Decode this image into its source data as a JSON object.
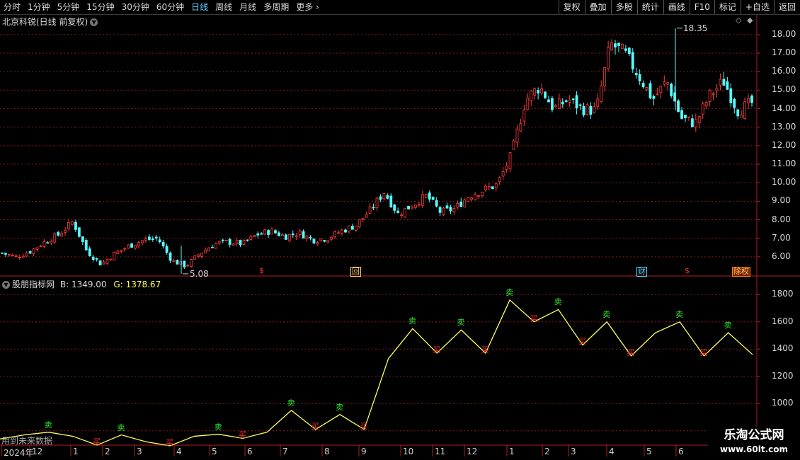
{
  "toolbar": {
    "periods": [
      "分时",
      "1分钟",
      "5分钟",
      "15分钟",
      "30分钟",
      "60分钟",
      "日线",
      "周线",
      "月线",
      "多周期",
      "更多"
    ],
    "active_period": "日线",
    "buttons": [
      "复权",
      "叠加",
      "多股",
      "统计",
      "画线",
      "F10",
      "标记",
      "+自选",
      "返回"
    ]
  },
  "main_pane": {
    "title": "北京科锐(日线 前复权)",
    "high_label": "18.35",
    "low_label": "5.08",
    "event_markers": [
      "$",
      "回",
      "财",
      "$",
      "除权"
    ]
  },
  "indicator_pane": {
    "title": "股朋指标网",
    "b_label": "B:",
    "b_value": "1349.00",
    "g_label": "G:",
    "g_value": "1378.67",
    "buy_label": "买",
    "sell_label": "卖",
    "future_note": "用到未来数据"
  },
  "price_axis": [
    "18.00",
    "17.00",
    "16.00",
    "15.00",
    "14.00",
    "13.00",
    "12.00",
    "11.00",
    "10.00",
    "9.00",
    "8.00",
    "7.00",
    "6.00"
  ],
  "indicator_axis": [
    "1800",
    "1600",
    "1400",
    "1200",
    "1000",
    "800.0"
  ],
  "date_axis": [
    "2024年",
    "12",
    "1",
    "2",
    "3",
    "4",
    "5",
    "6",
    "7",
    "8",
    "9",
    "10",
    "11",
    "12",
    "1",
    "2",
    "3",
    "4",
    "5",
    "6"
  ],
  "colors": {
    "up": "#ff3c3c",
    "down": "#54ffff",
    "grid": "#8b1a1a",
    "indicator_line": "#ffff60"
  },
  "watermark": {
    "title": "乐淘公式网",
    "url": "www.60lt.com"
  },
  "chart_data": [
    {
      "type": "candlestick",
      "title": "北京科锐(日线 前复权)",
      "ylim": [
        5,
        18.8
      ],
      "annotations": {
        "high": 18.35,
        "low": 5.08
      },
      "close_path": [
        6.2,
        6.0,
        6.3,
        6.8,
        7.2,
        7.9,
        6.3,
        5.6,
        6.2,
        6.6,
        6.9,
        7.0,
        5.8,
        5.5,
        6.2,
        6.7,
        6.8,
        6.7,
        7.2,
        7.4,
        7.1,
        7.3,
        6.9,
        7.0,
        7.4,
        7.7,
        8.5,
        9.5,
        8.3,
        8.8,
        9.3,
        8.4,
        8.6,
        9.3,
        9.6,
        9.9,
        11.5,
        14.5,
        15.2,
        14.0,
        14.5,
        14.0,
        13.9,
        17.5,
        17.0,
        15.8,
        14.5,
        15.5,
        13.5,
        13.2,
        14.7,
        15.5,
        13.9,
        14.3
      ]
    },
    {
      "type": "line",
      "title": "股朋指标网",
      "ylim": [
        700,
        1900
      ],
      "values": [
        740,
        770,
        790,
        760,
        695,
        770,
        720,
        690,
        760,
        775,
        745,
        790,
        950,
        810,
        920,
        810,
        1330,
        1550,
        1370,
        1540,
        1370,
        1760,
        1600,
        1690,
        1430,
        1600,
        1350,
        1520,
        1600,
        1350,
        1520,
        1360
      ]
    }
  ]
}
